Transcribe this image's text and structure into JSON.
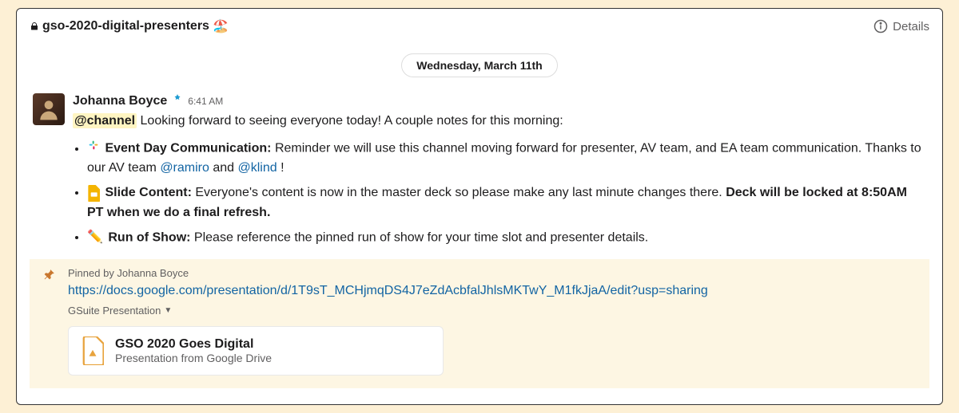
{
  "header": {
    "channel_name": "gso-2020-digital-presenters",
    "channel_emoji": "🏖️",
    "details_label": "Details"
  },
  "date_divider": "Wednesday, March 11th",
  "message": {
    "author": "Johanna Boyce",
    "timestamp": "6:41 AM",
    "channel_mention": "@channel",
    "intro_text": "Looking forward to seeing everyone today! A couple notes for this morning:",
    "bullets": [
      {
        "title": "Event Day Communication:",
        "body_before": "Reminder we will use this channel moving forward for presenter, AV team, and EA team communication. Thanks to our AV team",
        "mention1": "@ramiro",
        "body_mid": "and",
        "mention2": "@klind",
        "body_after": "!"
      },
      {
        "title": "Slide Content:",
        "body_before": "Everyone's content is now in the master deck so please make any last minute changes there.",
        "bold_tail": "Deck will be locked at 8:50AM PT when we do a final refresh."
      },
      {
        "title": "Run of Show:",
        "body_before": "Please reference the pinned run of show for your time slot and presenter details."
      }
    ]
  },
  "pinned": {
    "pinned_by": "Pinned by Johanna Boyce",
    "url": "https://docs.google.com/presentation/d/1T9sT_MCHjmqDS4J7eZdAcbfalJhlsMKTwY_M1fkJjaA/edit?usp=sharing",
    "preview_label": "GSuite Presentation",
    "preview_title": "GSO 2020 Goes Digital",
    "preview_sub": "Presentation from Google Drive"
  }
}
